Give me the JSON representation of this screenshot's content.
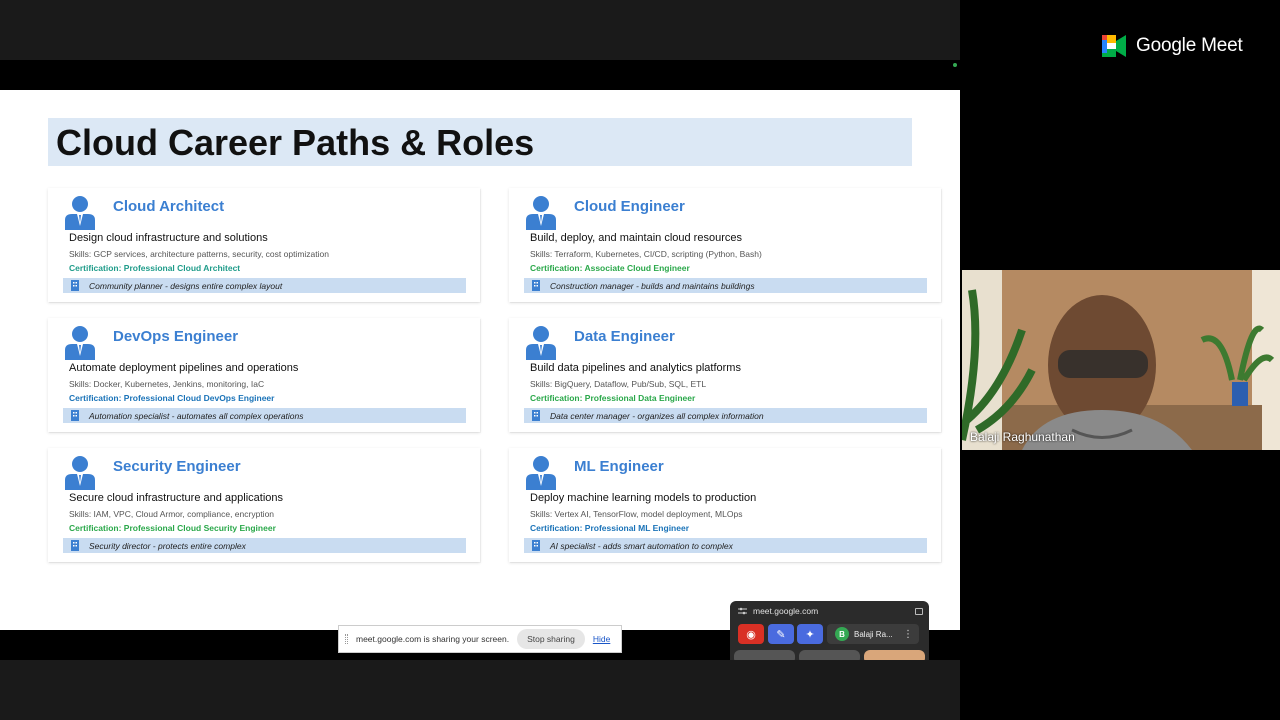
{
  "meet": {
    "brand": "Google Meet"
  },
  "slide": {
    "title": "Cloud Career Paths & Roles",
    "cards": [
      {
        "role": "Cloud Architect",
        "desc": "Design cloud infrastructure and solutions",
        "skills": "Skills: GCP services, architecture patterns, security, cost optimization",
        "cert": "Certification: Professional Cloud Architect",
        "analogy": "Community planner - designs entire complex layout"
      },
      {
        "role": "Cloud Engineer",
        "desc": "Build, deploy, and maintain cloud resources",
        "skills": "Skills: Terraform, Kubernetes, CI/CD, scripting (Python, Bash)",
        "cert": "Certification: Associate Cloud Engineer",
        "analogy": "Construction manager - builds and maintains buildings"
      },
      {
        "role": "DevOps Engineer",
        "desc": "Automate deployment pipelines and operations",
        "skills": "Skills: Docker, Kubernetes, Jenkins, monitoring, IaC",
        "cert": "Certification: Professional Cloud DevOps Engineer",
        "analogy": "Automation specialist - automates all complex operations"
      },
      {
        "role": "Data Engineer",
        "desc": "Build data pipelines and analytics platforms",
        "skills": "Skills: BigQuery, Dataflow, Pub/Sub, SQL, ETL",
        "cert": "Certification: Professional Data Engineer",
        "analogy": "Data center manager - organizes all complex information"
      },
      {
        "role": "Security Engineer",
        "desc": "Secure cloud infrastructure and applications",
        "skills": "Skills: IAM, VPC, Cloud Armor, compliance, encryption",
        "cert": "Certification: Professional Cloud Security Engineer",
        "analogy": "Security director - protects entire complex"
      },
      {
        "role": "ML Engineer",
        "desc": "Deploy machine learning models to production",
        "skills": "Skills: Vertex AI, TensorFlow, model deployment, MLOps",
        "cert": "Certification: Professional ML Engineer",
        "analogy": "AI specialist - adds smart automation to complex"
      }
    ]
  },
  "participant": {
    "name": "Balaji Raghunathan"
  },
  "share_bar": {
    "message": "meet.google.com is sharing your screen.",
    "stop_label": "Stop sharing",
    "hide_label": "Hide"
  },
  "pip": {
    "url": "meet.google.com",
    "avatar_letter": "B",
    "name": "Balaji Ra..."
  }
}
